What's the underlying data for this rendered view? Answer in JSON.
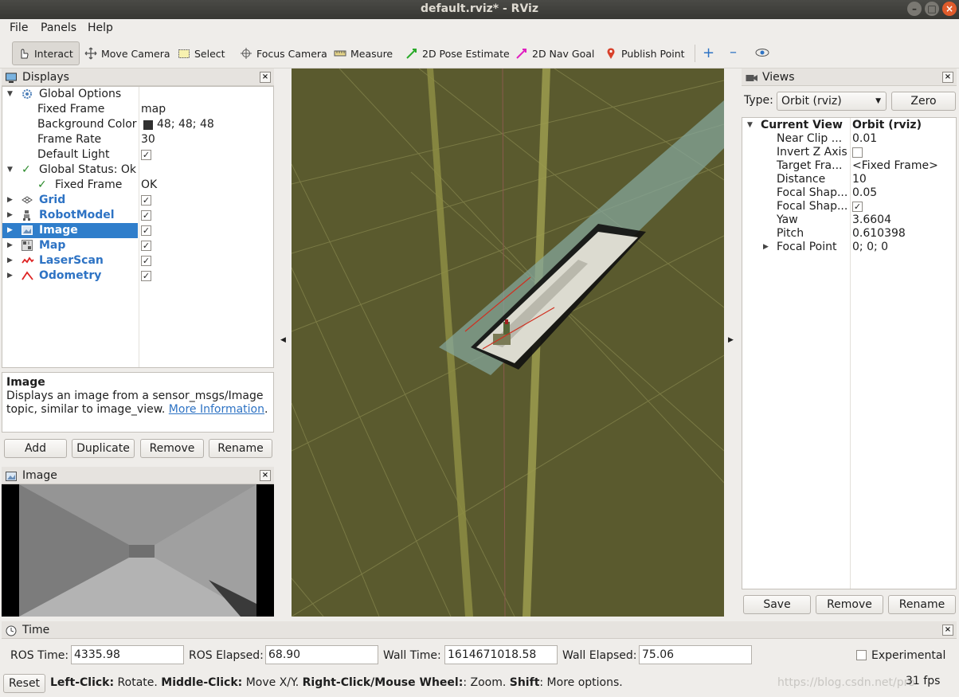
{
  "window": {
    "title": "default.rviz* - RViz"
  },
  "menu": [
    "File",
    "Panels",
    "Help"
  ],
  "toolbar": {
    "interact": "Interact",
    "move_camera": "Move Camera",
    "select": "Select",
    "focus_camera": "Focus Camera",
    "measure": "Measure",
    "pose_estimate": "2D Pose Estimate",
    "nav_goal": "2D Nav Goal",
    "publish_point": "Publish Point"
  },
  "displays": {
    "title": "Displays",
    "global_options": "Global Options",
    "fixed_frame_label": "Fixed Frame",
    "fixed_frame_value": "map",
    "bg_color_label": "Background Color",
    "bg_color_value": "48; 48; 48",
    "frame_rate_label": "Frame Rate",
    "frame_rate_value": "30",
    "default_light_label": "Default Light",
    "global_status": "Global Status: Ok",
    "status_fixed_frame": "Fixed Frame",
    "status_ok": "OK",
    "items": [
      "Grid",
      "RobotModel",
      "Image",
      "Map",
      "LaserScan",
      "Odometry"
    ],
    "desc_title": "Image",
    "desc_text": "Displays an image from a sensor_msgs/Image topic, similar to image_view.",
    "desc_link": "More Information",
    "desc_end": ".",
    "buttons": {
      "add": "Add",
      "duplicate": "Duplicate",
      "remove": "Remove",
      "rename": "Rename"
    }
  },
  "image_panel": {
    "title": "Image"
  },
  "views": {
    "title": "Views",
    "type_label": "Type:",
    "type_value": "Orbit (rviz)",
    "zero": "Zero",
    "current_view": "Current View",
    "current_view_value": "Orbit (rviz)",
    "props": [
      {
        "label": "Near Clip ...",
        "value": "0.01"
      },
      {
        "label": "Invert Z Axis",
        "value": ""
      },
      {
        "label": "Target Fra...",
        "value": "<Fixed Frame>"
      },
      {
        "label": "Distance",
        "value": "10"
      },
      {
        "label": "Focal Shap...",
        "value": "0.05"
      },
      {
        "label": "Focal Shap...",
        "value": ""
      },
      {
        "label": "Yaw",
        "value": "3.6604"
      },
      {
        "label": "Pitch",
        "value": "0.610398"
      },
      {
        "label": "Focal Point",
        "value": "0; 0; 0"
      }
    ],
    "buttons": {
      "save": "Save",
      "remove": "Remove",
      "rename": "Rename"
    }
  },
  "time": {
    "title": "Time",
    "ros_time_label": "ROS Time:",
    "ros_time": "4335.98",
    "ros_elapsed_label": "ROS Elapsed:",
    "ros_elapsed": "68.90",
    "wall_time_label": "Wall Time:",
    "wall_time": "1614671018.58",
    "wall_elapsed_label": "Wall Elapsed:",
    "wall_elapsed": "75.06",
    "experimental": "Experimental"
  },
  "status": {
    "reset": "Reset",
    "k1": "Left-Click:",
    "t1": " Rotate. ",
    "k2": "Middle-Click:",
    "t2": " Move X/Y. ",
    "k3": "Right-Click/Mouse Wheel:",
    "t3": ": Zoom. ",
    "k4": "Shift",
    "t4": ": More options.",
    "fps": "31 fps",
    "watermark": "https://blog.csdn.net/pro"
  },
  "colors": {
    "viewport_bg": "#5a5a2e",
    "selection": "#2f7ecb",
    "link": "#2e73c4"
  }
}
